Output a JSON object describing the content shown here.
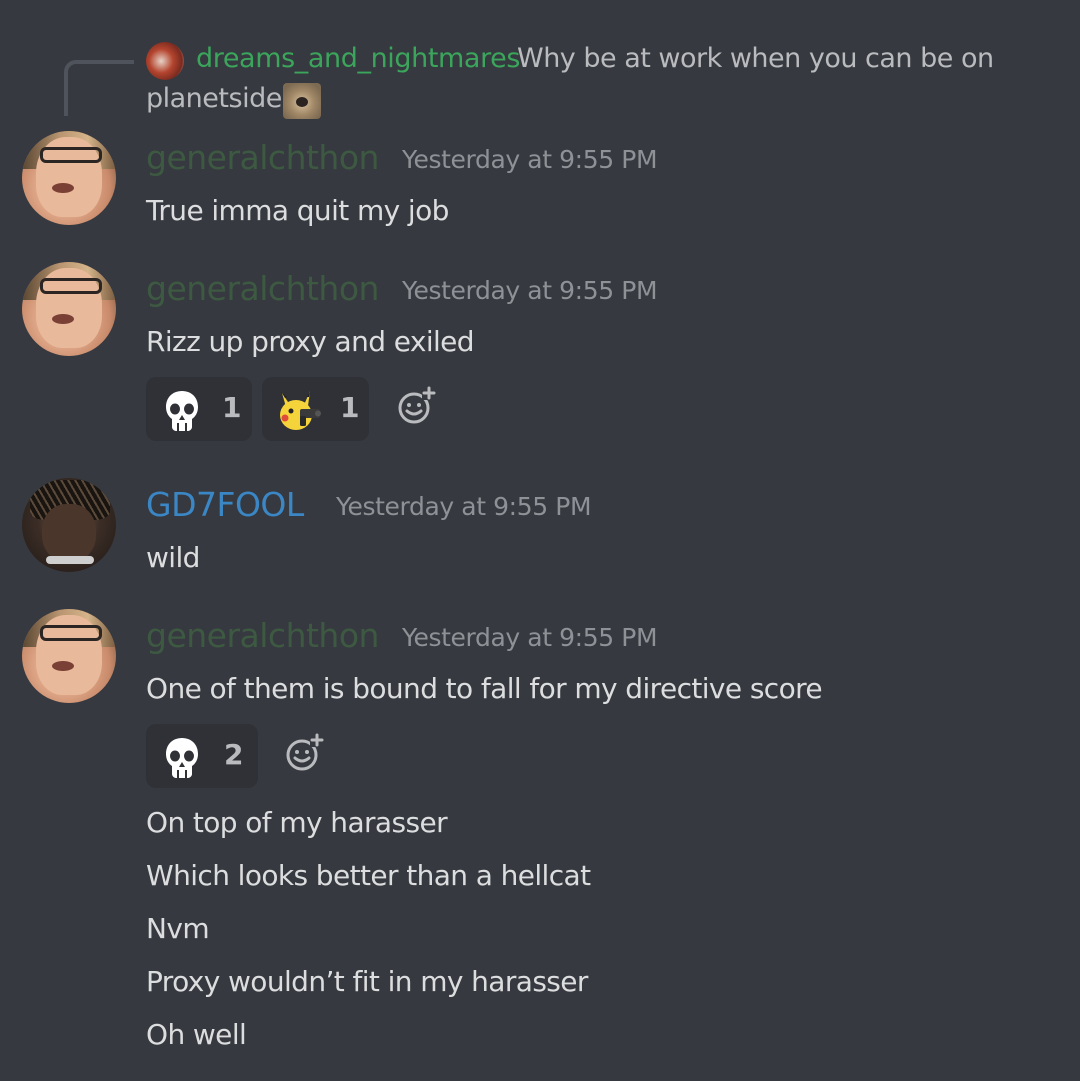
{
  "reply": {
    "username": "dreams_and_nightmares",
    "text_line1": "Why be at work when you can be on",
    "text_line2": "planetside",
    "emoji_icon": "dog-emoji-icon",
    "username_color": "#3ba55c"
  },
  "messages": [
    {
      "username": "generalchthon",
      "timestamp": "Yesterday at 9:55 PM",
      "text": "True imma quit my job",
      "username_color": "#3d5942"
    },
    {
      "username": "generalchthon",
      "timestamp": "Yesterday at 9:55 PM",
      "text": "Rizz up proxy and exiled",
      "username_color": "#3d5942",
      "reactions": [
        {
          "emoji": "skull-icon",
          "count": "1"
        },
        {
          "emoji": "pikachu-gun-icon",
          "count": "1"
        }
      ]
    },
    {
      "username": "GD7FOOL",
      "timestamp": "Yesterday at 9:55 PM",
      "text": "wild",
      "username_color": "#3b86c4"
    },
    {
      "username": "generalchthon",
      "timestamp": "Yesterday at 9:55 PM",
      "text": "One of them is bound to fall for my directive score",
      "username_color": "#3d5942",
      "reactions": [
        {
          "emoji": "skull-icon",
          "count": "2"
        }
      ],
      "followups": [
        "On top of my harasser",
        "Which looks better than a hellcat",
        "Nvm",
        "Proxy wouldn’t fit in my harasser",
        "Oh well"
      ]
    }
  ],
  "colors": {
    "background": "#36393f",
    "reaction_bg": "#2f3136",
    "timestamp": "#8e9297",
    "text": "#dcddde"
  }
}
